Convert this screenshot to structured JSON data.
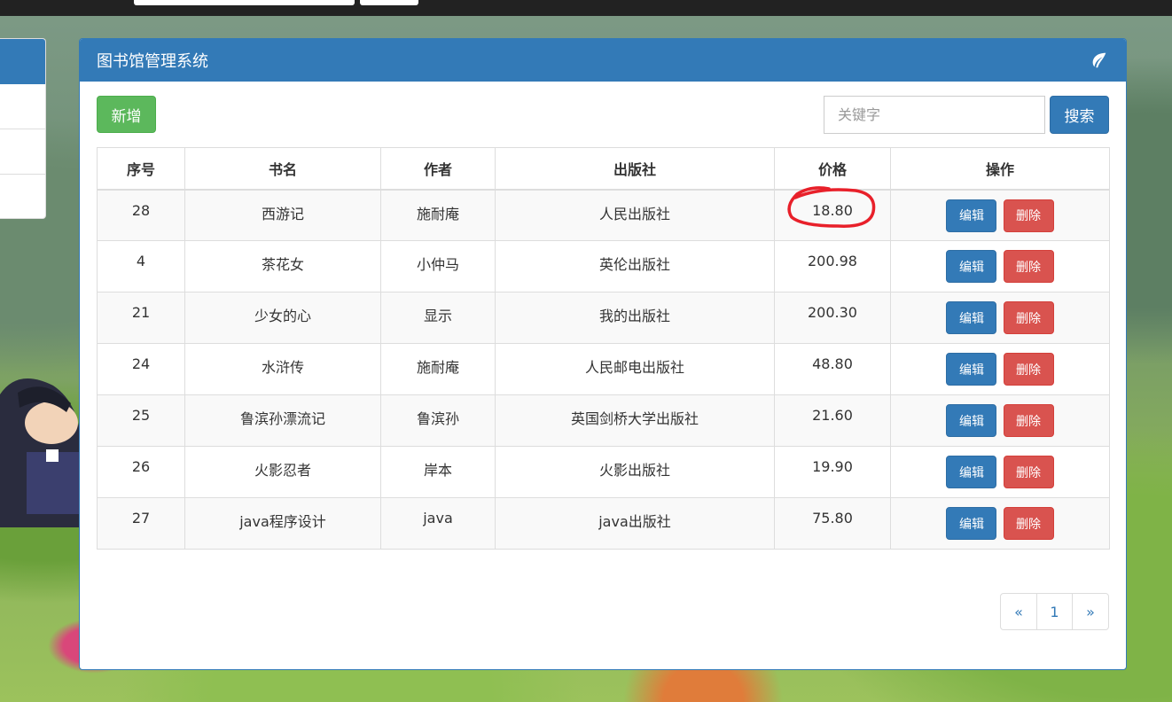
{
  "panel": {
    "title": "图书馆管理系统",
    "header_icon": "leaf-icon"
  },
  "toolbar": {
    "add_label": "新增",
    "search_placeholder": "关键字",
    "search_label": "搜索"
  },
  "table": {
    "headers": [
      "序号",
      "书名",
      "作者",
      "出版社",
      "价格",
      "操作"
    ],
    "rows": [
      {
        "id": "28",
        "name": "西游记",
        "author": "施耐庵",
        "publisher": "人民出版社",
        "price": "18.80"
      },
      {
        "id": "4",
        "name": "茶花女",
        "author": "小仲马",
        "publisher": "英伦出版社",
        "price": "200.98"
      },
      {
        "id": "21",
        "name": "少女的心",
        "author": "显示",
        "publisher": "我的出版社",
        "price": "200.30"
      },
      {
        "id": "24",
        "name": "水浒传",
        "author": "施耐庵",
        "publisher": "人民邮电出版社",
        "price": "48.80"
      },
      {
        "id": "25",
        "name": "鲁滨孙漂流记",
        "author": "鲁滨孙",
        "publisher": "英国剑桥大学出版社",
        "price": "21.60"
      },
      {
        "id": "26",
        "name": "火影忍者",
        "author": "岸本",
        "publisher": "火影出版社",
        "price": "19.90"
      },
      {
        "id": "27",
        "name": "java程序设计",
        "author": "java",
        "publisher": "java出版社",
        "price": "75.80"
      }
    ],
    "edit_label": "编辑",
    "delete_label": "删除"
  },
  "pagination": {
    "prev": "«",
    "current": "1",
    "next": "»"
  },
  "colors": {
    "primary": "#337ab7",
    "success": "#5cb85c",
    "danger": "#d9534f",
    "annotation": "#e8202a"
  }
}
